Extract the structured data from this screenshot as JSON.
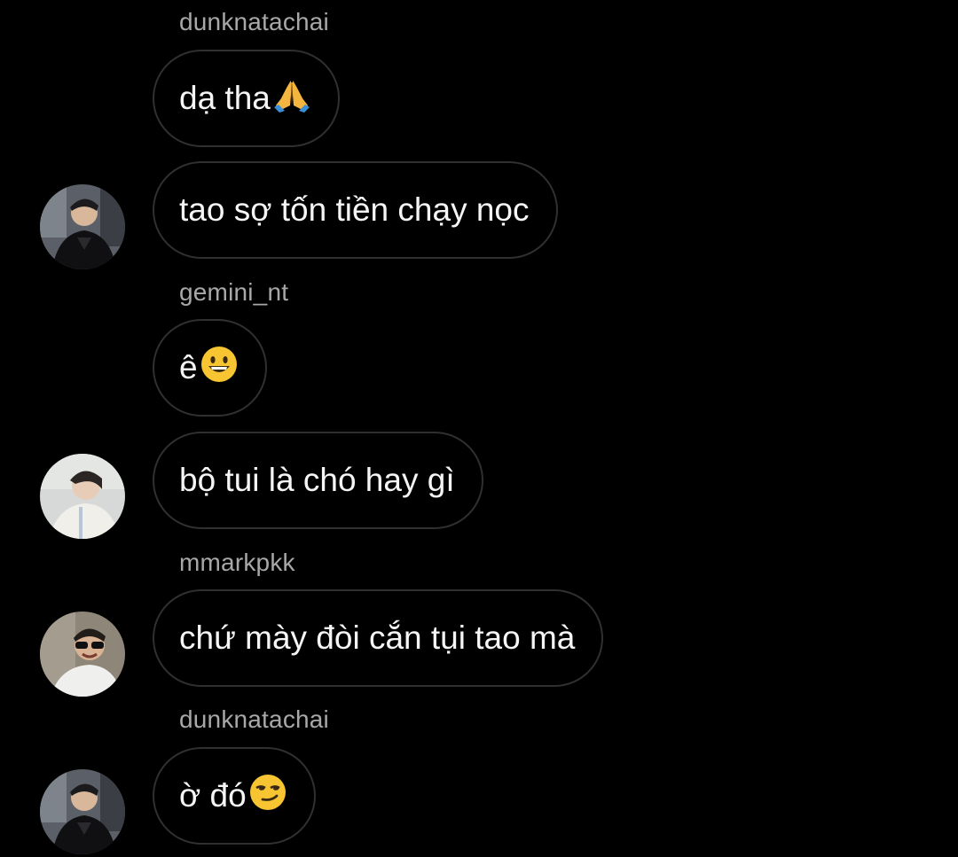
{
  "colors": {
    "background": "#000000",
    "bubble_border": "#303030",
    "username_text": "#a8a8a8",
    "message_text": "#f5f5f5"
  },
  "thread": [
    {
      "username": "dunknatachai"
    },
    {
      "text": "dạ tha",
      "emoji": "folded-hands-icon"
    },
    {
      "text": "tao sợ tốn tiền chạy nọc",
      "avatar": "avatar-dunknatachai"
    },
    {
      "username": "gemini_nt"
    },
    {
      "text": "ê ",
      "emoji": "smiling-face-icon"
    },
    {
      "text": "bộ tui là chó hay gì",
      "avatar": "avatar-gemini_nt"
    },
    {
      "username": "mmarkpkk"
    },
    {
      "text": "chứ mày đòi cắn tụi tao mà",
      "avatar": "avatar-mmarkpkk"
    },
    {
      "username": "dunknatachai"
    },
    {
      "text": "ờ đó",
      "emoji": "smirking-face-icon",
      "avatar": "avatar-dunknatachai"
    }
  ]
}
